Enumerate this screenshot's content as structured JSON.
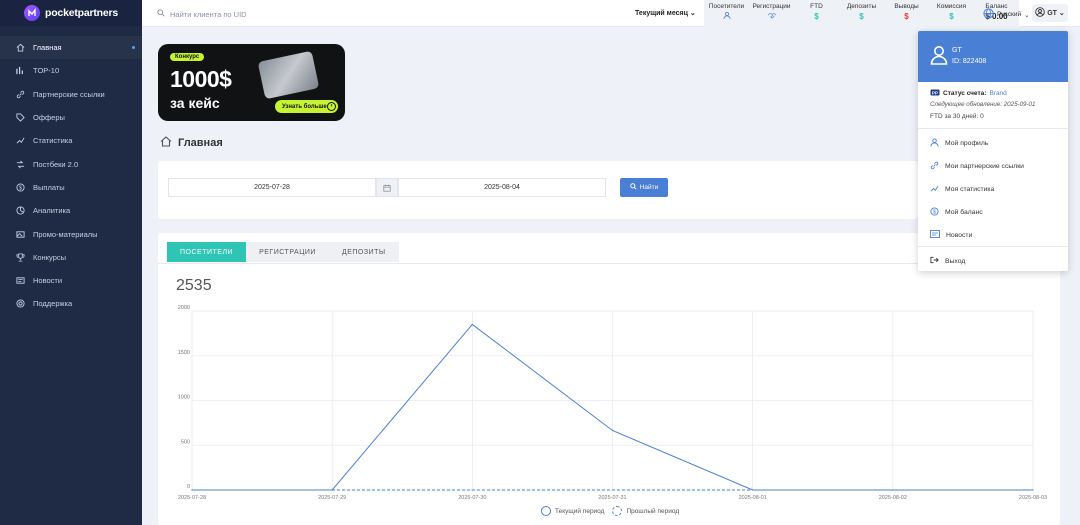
{
  "brand": {
    "name": "pocketpartners"
  },
  "sidebar": {
    "items": [
      {
        "label": "Главная",
        "icon": "home-icon",
        "active": true
      },
      {
        "label": "TOP-10",
        "icon": "bar-chart-icon"
      },
      {
        "label": "Партнерские ссылки",
        "icon": "link-icon"
      },
      {
        "label": "Офферы",
        "icon": "tag-icon"
      },
      {
        "label": "Статистика",
        "icon": "line-chart-icon"
      },
      {
        "label": "Постбеки 2.0",
        "icon": "postback-icon"
      },
      {
        "label": "Выплаты",
        "icon": "dollar-icon"
      },
      {
        "label": "Аналитика",
        "icon": "analytics-icon"
      },
      {
        "label": "Промо-материалы",
        "icon": "promo-icon"
      },
      {
        "label": "Конкурсы",
        "icon": "trophy-icon"
      },
      {
        "label": "Новости",
        "icon": "news-icon"
      },
      {
        "label": "Поддержка",
        "icon": "support-icon"
      }
    ]
  },
  "topbar": {
    "search_placeholder": "Найти клиента по UID",
    "period": "Текущий месяц",
    "stats": [
      {
        "label": "Посетители",
        "value": "",
        "icon": "visitors-icon"
      },
      {
        "label": "Регистрации",
        "value": "",
        "icon": "registrations-icon"
      },
      {
        "label": "FTD",
        "value": "$",
        "color": "#2fc5b5"
      },
      {
        "label": "Депозиты",
        "value": "$",
        "color": "#2fc5b5"
      },
      {
        "label": "Выводы",
        "value": "$",
        "color": "#e53935"
      },
      {
        "label": "Комиссия",
        "value": "$",
        "color": "#2fc5b5"
      },
      {
        "label": "Баланс",
        "value": "$ 0.00",
        "color": "#222222"
      }
    ],
    "language": "Русский",
    "user_initials": "GT"
  },
  "banner": {
    "tag": "Конкурс",
    "amount": "1000$",
    "subtitle": "за кейс",
    "button": "Узнать больше"
  },
  "page": {
    "title": "Главная"
  },
  "filter": {
    "date_from": "2025-07-28",
    "date_to": "2025-08-04",
    "find_label": "Найти"
  },
  "chart_tabs": [
    {
      "label": "ПОСЕТИТЕЛИ",
      "active": true
    },
    {
      "label": "РЕГИСТРАЦИИ",
      "active": false
    },
    {
      "label": "ДЕПОЗИТЫ",
      "active": false
    }
  ],
  "total": "2535",
  "chart_data": {
    "type": "line",
    "x": [
      "2025-07-28",
      "2025-07-29",
      "2025-07-30",
      "2025-07-31",
      "2025-08-01",
      "2025-08-02",
      "2025-08-03"
    ],
    "yticks": [
      "0",
      "500",
      "1000",
      "1500",
      "2000"
    ],
    "ylim": [
      0,
      2000
    ],
    "series": [
      {
        "name": "Текущий период",
        "values": [
          0,
          0,
          1850,
          665,
          0,
          0,
          0
        ],
        "color": "#4a7fd6",
        "dashed": false
      },
      {
        "name": "Прошлый период",
        "values": [
          0,
          0,
          0,
          0,
          0,
          0,
          0
        ],
        "color": "#4a7fd6",
        "dashed": true
      }
    ],
    "grid": true,
    "legend": "bottom"
  },
  "dropdown": {
    "name": "GT",
    "id": "ID: 822408",
    "status_label": "Статус счета:",
    "status_value": "Brand",
    "next_update": "Следующее обновление: 2025-09-01",
    "ftd": "FTD за 30 дней: 0",
    "items": [
      {
        "label": "Мой профиль",
        "icon": "profile-icon"
      },
      {
        "label": "Мои партнерские ссылки",
        "icon": "link-icon"
      },
      {
        "label": "Моя статистика",
        "icon": "stats-icon"
      },
      {
        "label": "Мой баланс",
        "icon": "balance-icon"
      },
      {
        "label": "Новости",
        "icon": "news-icon"
      }
    ],
    "logout": "Выход"
  }
}
